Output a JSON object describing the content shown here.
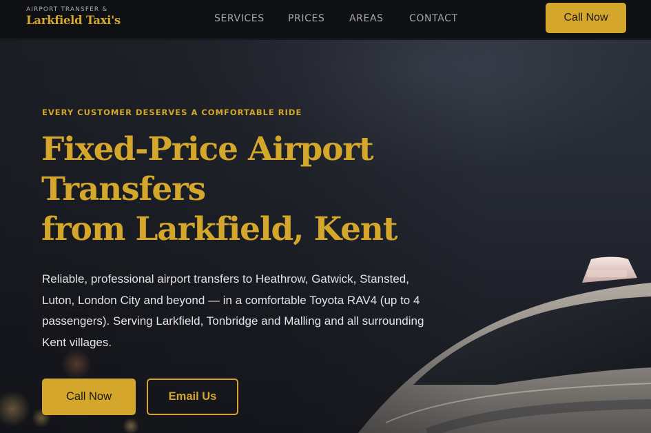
{
  "header": {
    "brand_tag": "AIRPORT TRANSFER &",
    "brand_name": "Larkfield Taxi's",
    "nav": [
      "SERVICES",
      "PRICES",
      "AREAS",
      "CONTACT"
    ],
    "cta_label": "Call Now"
  },
  "hero": {
    "eyebrow": "EVERY CUSTOMER DESERVES A COMFORTABLE RIDE",
    "headline_lines": [
      "Fixed-Price Airport",
      "Transfers",
      "from Larkfield, Kent"
    ],
    "lead": "Reliable, professional airport transfers to Heathrow, Gatwick, Stansted, Luton, London City and beyond — in a comfortable Toyota RAV4 (up to 4 passengers). Serving Larkfield, Tonbridge and Malling and all surrounding Kent villages.",
    "primary_button": "Call Now",
    "secondary_button": "Email Us"
  },
  "colors": {
    "accent": "#d4a72c",
    "header_bg": "#0e1014",
    "hero_bg": "#262a33",
    "body_text": "#e4e4e6",
    "nav_text": "#a8a9ae"
  },
  "icons": [
    "taxi-roof-sign-icon"
  ]
}
